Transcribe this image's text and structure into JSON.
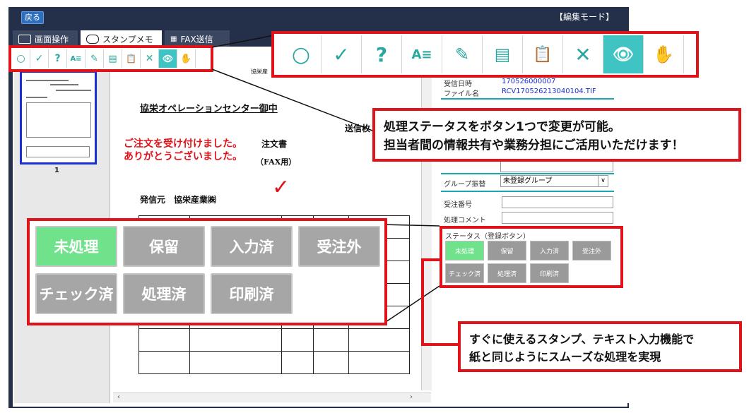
{
  "app": {
    "back_label": "戻る",
    "mode_label": "【編集モード】"
  },
  "tabs": [
    {
      "label": "画面操作",
      "icon": "monitor-icon",
      "active": false
    },
    {
      "label": "スタンプメモ",
      "icon": "chat-icon",
      "active": true
    },
    {
      "label": "FAX送信",
      "icon": "fax-icon",
      "active": false
    }
  ],
  "toolbar": {
    "tools": [
      {
        "glyph": "○",
        "icon": "circle-icon"
      },
      {
        "glyph": "✓",
        "icon": "check-icon"
      },
      {
        "glyph": "?",
        "icon": "question-icon"
      },
      {
        "glyph": "A≡",
        "icon": "text-icon"
      },
      {
        "glyph": "✎",
        "icon": "pen-icon"
      },
      {
        "glyph": "▤",
        "icon": "document-icon"
      },
      {
        "glyph": "📋",
        "icon": "clipboard-icon"
      },
      {
        "glyph": "✕",
        "icon": "cross-icon"
      },
      {
        "glyph": "👁",
        "icon": "eye-icon",
        "active": true
      },
      {
        "glyph": "✋",
        "icon": "hand-icon"
      }
    ]
  },
  "thumbnail": {
    "page_number": "1"
  },
  "document": {
    "header_fragment": "協栄産",
    "recipient": "協栄オペレーションセンター御中",
    "received_note_line1": "ご注文を受け付けました。",
    "received_note_line2": "ありがとうございました。",
    "order_title": "注文書",
    "fax_label": "（FAX用）",
    "sender_label": "送信枚",
    "origin": "発信元　協栄産業㈱",
    "check_mark": "✓"
  },
  "info": {
    "received_datetime_label": "受信日時",
    "received_datetime_value": "170526000007",
    "filename_label": "ファイル名",
    "filename_value": "RCV170526213040104.TIF",
    "group_label": "グループ振替",
    "group_value": "未登録グループ",
    "order_number_label": "受注番号",
    "comment_label": "処理コメント",
    "status_label": "ステータス（登録ボタン）"
  },
  "status_buttons": [
    {
      "label": "未処理",
      "active": true
    },
    {
      "label": "保留",
      "active": false
    },
    {
      "label": "入力済",
      "active": false
    },
    {
      "label": "受注外",
      "active": false
    },
    {
      "label": "チェック済",
      "active": false
    },
    {
      "label": "処理済",
      "active": false
    },
    {
      "label": "印刷済",
      "active": false
    }
  ],
  "callouts": {
    "status_line1": "処理ステータスをボタン1つで変更が可能。",
    "status_line2": "担当者間の情報共有や業務分担にご活用いただけます！",
    "stamp_line1": "すぐに使えるスタンプ、テキスト入力機能で",
    "stamp_line2": "紙と同じようにスムーズな処理を実現"
  },
  "colors": {
    "accent_red": "#e0131b",
    "status_active": "#6fe28b",
    "toolbar_teal": "#3fc3c3",
    "window_navy": "#24304a",
    "link_blue": "#1a2fd8"
  }
}
